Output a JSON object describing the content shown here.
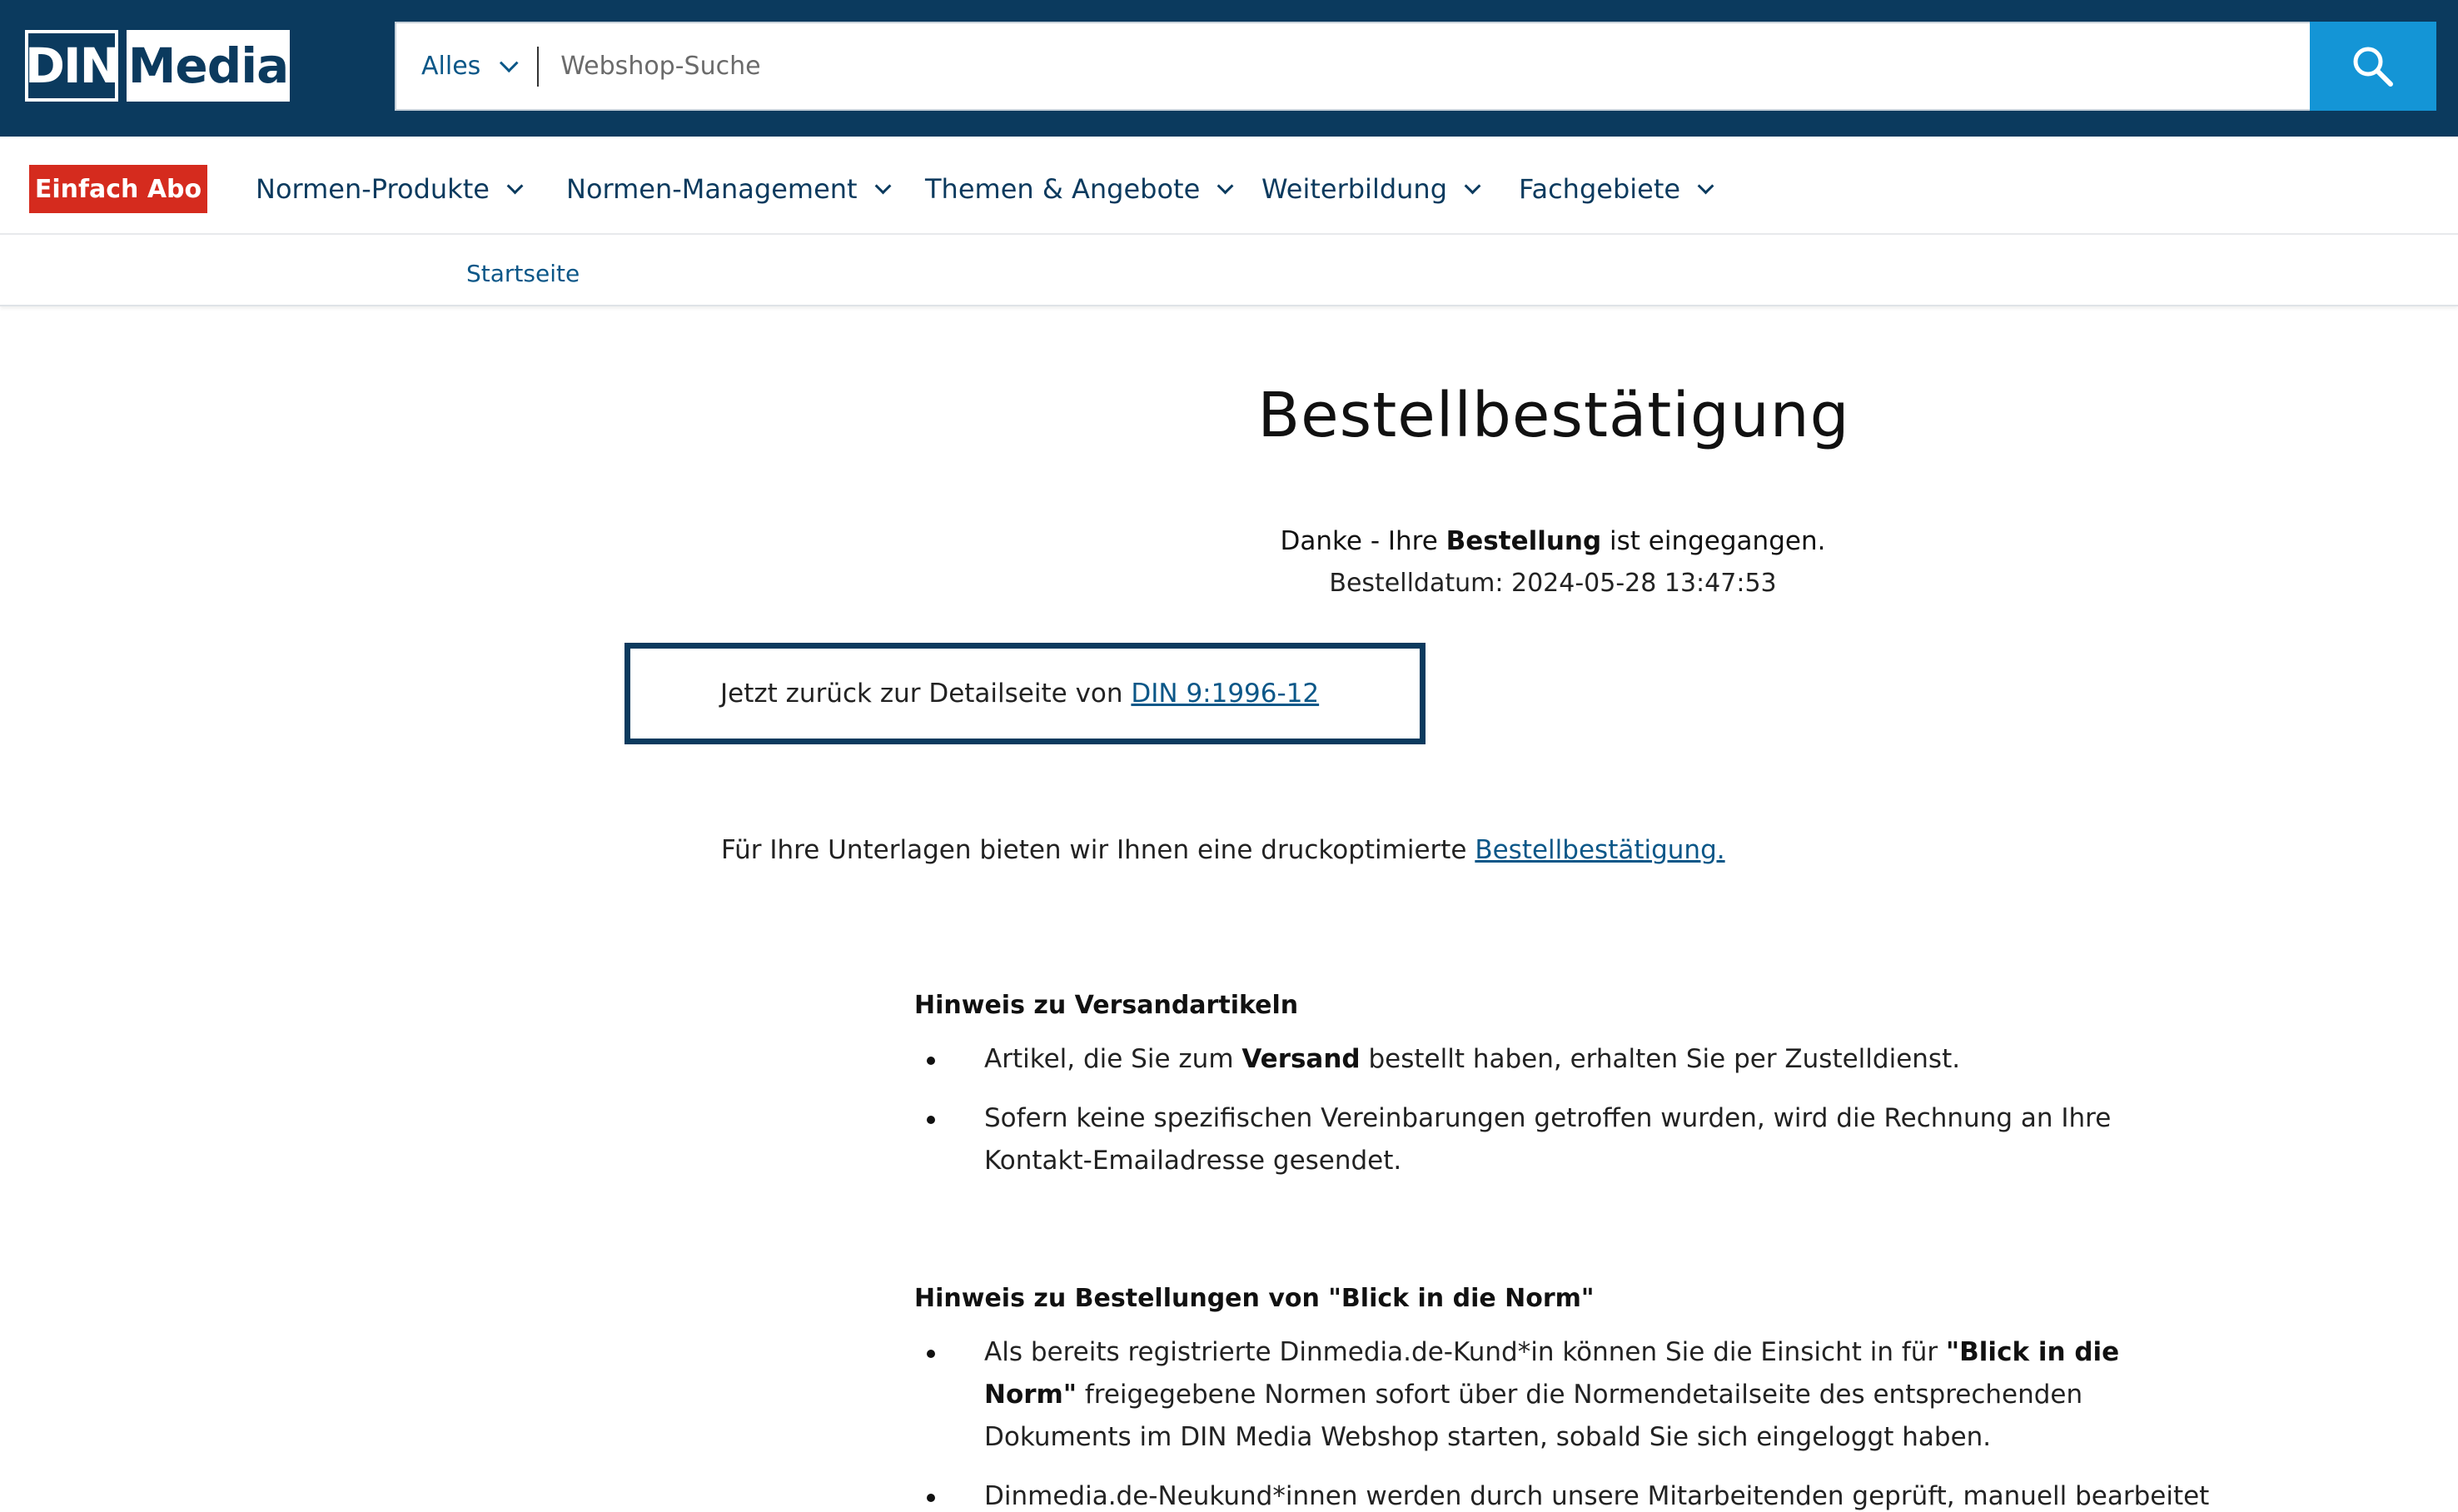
{
  "header": {
    "logo": {
      "left": "DIN",
      "right": "Media"
    },
    "search": {
      "scope_label": "Alles",
      "placeholder": "Webshop-Suche"
    }
  },
  "nav": {
    "abo_label": "Einfach Abo",
    "items": [
      {
        "label": "Normen-Produkte"
      },
      {
        "label": "Normen-Management"
      },
      {
        "label": "Themen & Angebote"
      },
      {
        "label": "Weiterbildung"
      },
      {
        "label": "Fachgebiete"
      }
    ]
  },
  "breadcrumb": {
    "home": "Startseite"
  },
  "main": {
    "title": "Bestellbestätigung",
    "thanks": {
      "pre": "Danke - Ihre ",
      "bold": "Bestellung",
      "post": " ist eingegangen."
    },
    "order_date": "Bestelldatum: 2024-05-28 13:47:53",
    "back_box": {
      "text": "Jetzt zurück zur Detailseite von ",
      "link": "DIN 9:1996-12"
    },
    "print": {
      "text": "Für Ihre Unterlagen bieten wir Ihnen eine druckoptimierte ",
      "link": "Bestellbestätigung."
    },
    "shipping": {
      "heading": "Hinweis zu Versandartikeln",
      "item1": {
        "pre": "Artikel, die Sie zum ",
        "bold": "Versand",
        "post": " bestellt haben, erhalten Sie per Zustelldienst."
      },
      "item2": "Sofern keine spezifischen Vereinbarungen getroffen wurden, wird die Rechnung an Ihre Kontakt-Emailadresse gesendet."
    },
    "blick": {
      "heading": "Hinweis zu Bestellungen von \"Blick in die Norm\"",
      "item1": {
        "pre": "Als bereits registrierte Dinmedia.de-Kund*in können Sie die Einsicht in für ",
        "bold": "\"Blick in die Norm\"",
        "post": " freigegebene Normen sofort über die Normendetailseite des entsprechenden Dokuments im DIN Media Webshop starten, sobald Sie sich eingeloggt haben."
      },
      "item2": "Dinmedia.de-Neukund*innen werden durch unsere Mitarbeitenden geprüft, manuell bearbeitet"
    }
  },
  "colors": {
    "header_bg": "#0b3a5e",
    "search_button": "#1495d6",
    "abo_button": "#d52b1e",
    "link": "#0b5788"
  },
  "icons": {
    "search": "search-icon",
    "chevron": "chevron-down-icon"
  }
}
